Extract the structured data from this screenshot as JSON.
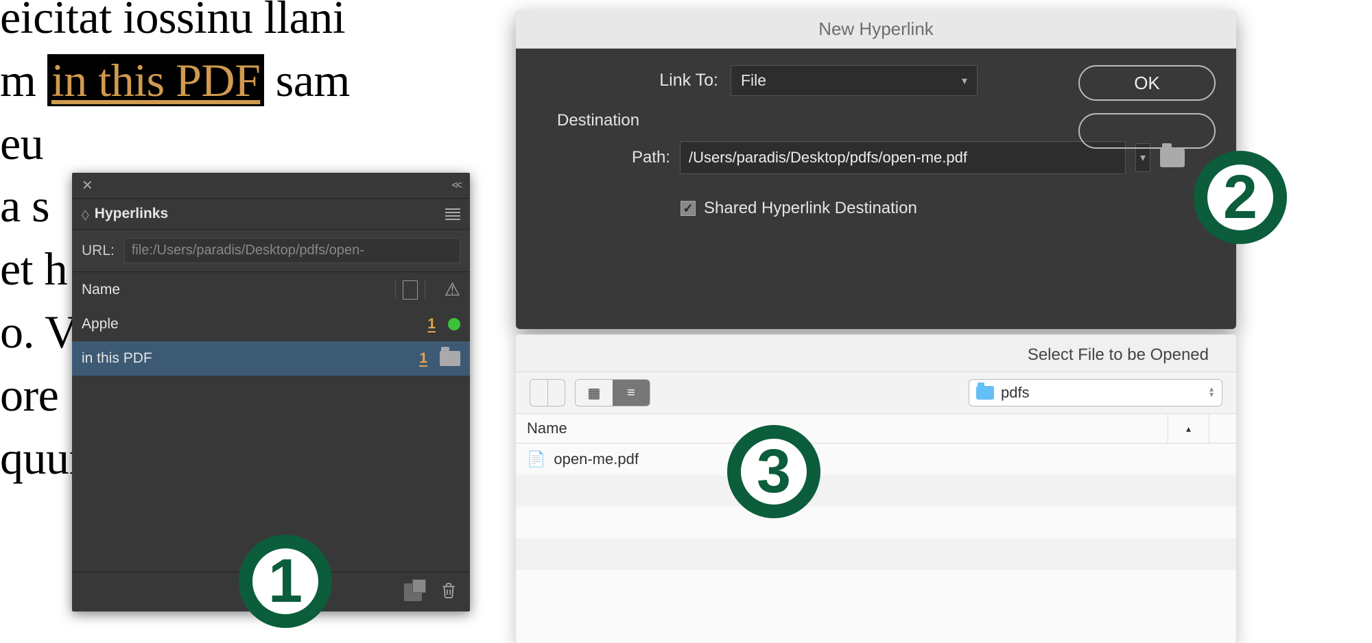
{
  "doc": {
    "line1": "eicitat iossinu llani",
    "line2a": "m ",
    "line2hl": "in this PDF",
    "line2b": " sam",
    "line3": "eu",
    "line4": "a s",
    "line5": "et h",
    "line6": "o. V",
    "line7": "ore",
    "line8": "quuntis a"
  },
  "hyperlinks_panel": {
    "tab_label": "Hyperlinks",
    "url_label": "URL:",
    "url_value": "file:/Users/paradis/Desktop/pdfs/open-",
    "name_col": "Name",
    "rows": [
      {
        "name": "Apple",
        "page": "1",
        "ok": true
      },
      {
        "name": "in this PDF",
        "page": "1",
        "folder": true
      }
    ]
  },
  "new_hyperlink": {
    "title": "New Hyperlink",
    "link_to_label": "Link To:",
    "link_to_value": "File",
    "ok": "OK",
    "destination_label": "Destination",
    "path_label": "Path:",
    "path_value": "/Users/paradis/Desktop/pdfs/open-me.pdf",
    "shared_label": "Shared Hyperlink Destination"
  },
  "file_picker": {
    "title": "Select File to be Opened",
    "folder": "pdfs",
    "name_col": "Name",
    "files": [
      "open-me.pdf"
    ]
  },
  "badges": {
    "b1": "1",
    "b2": "2",
    "b3": "3"
  }
}
